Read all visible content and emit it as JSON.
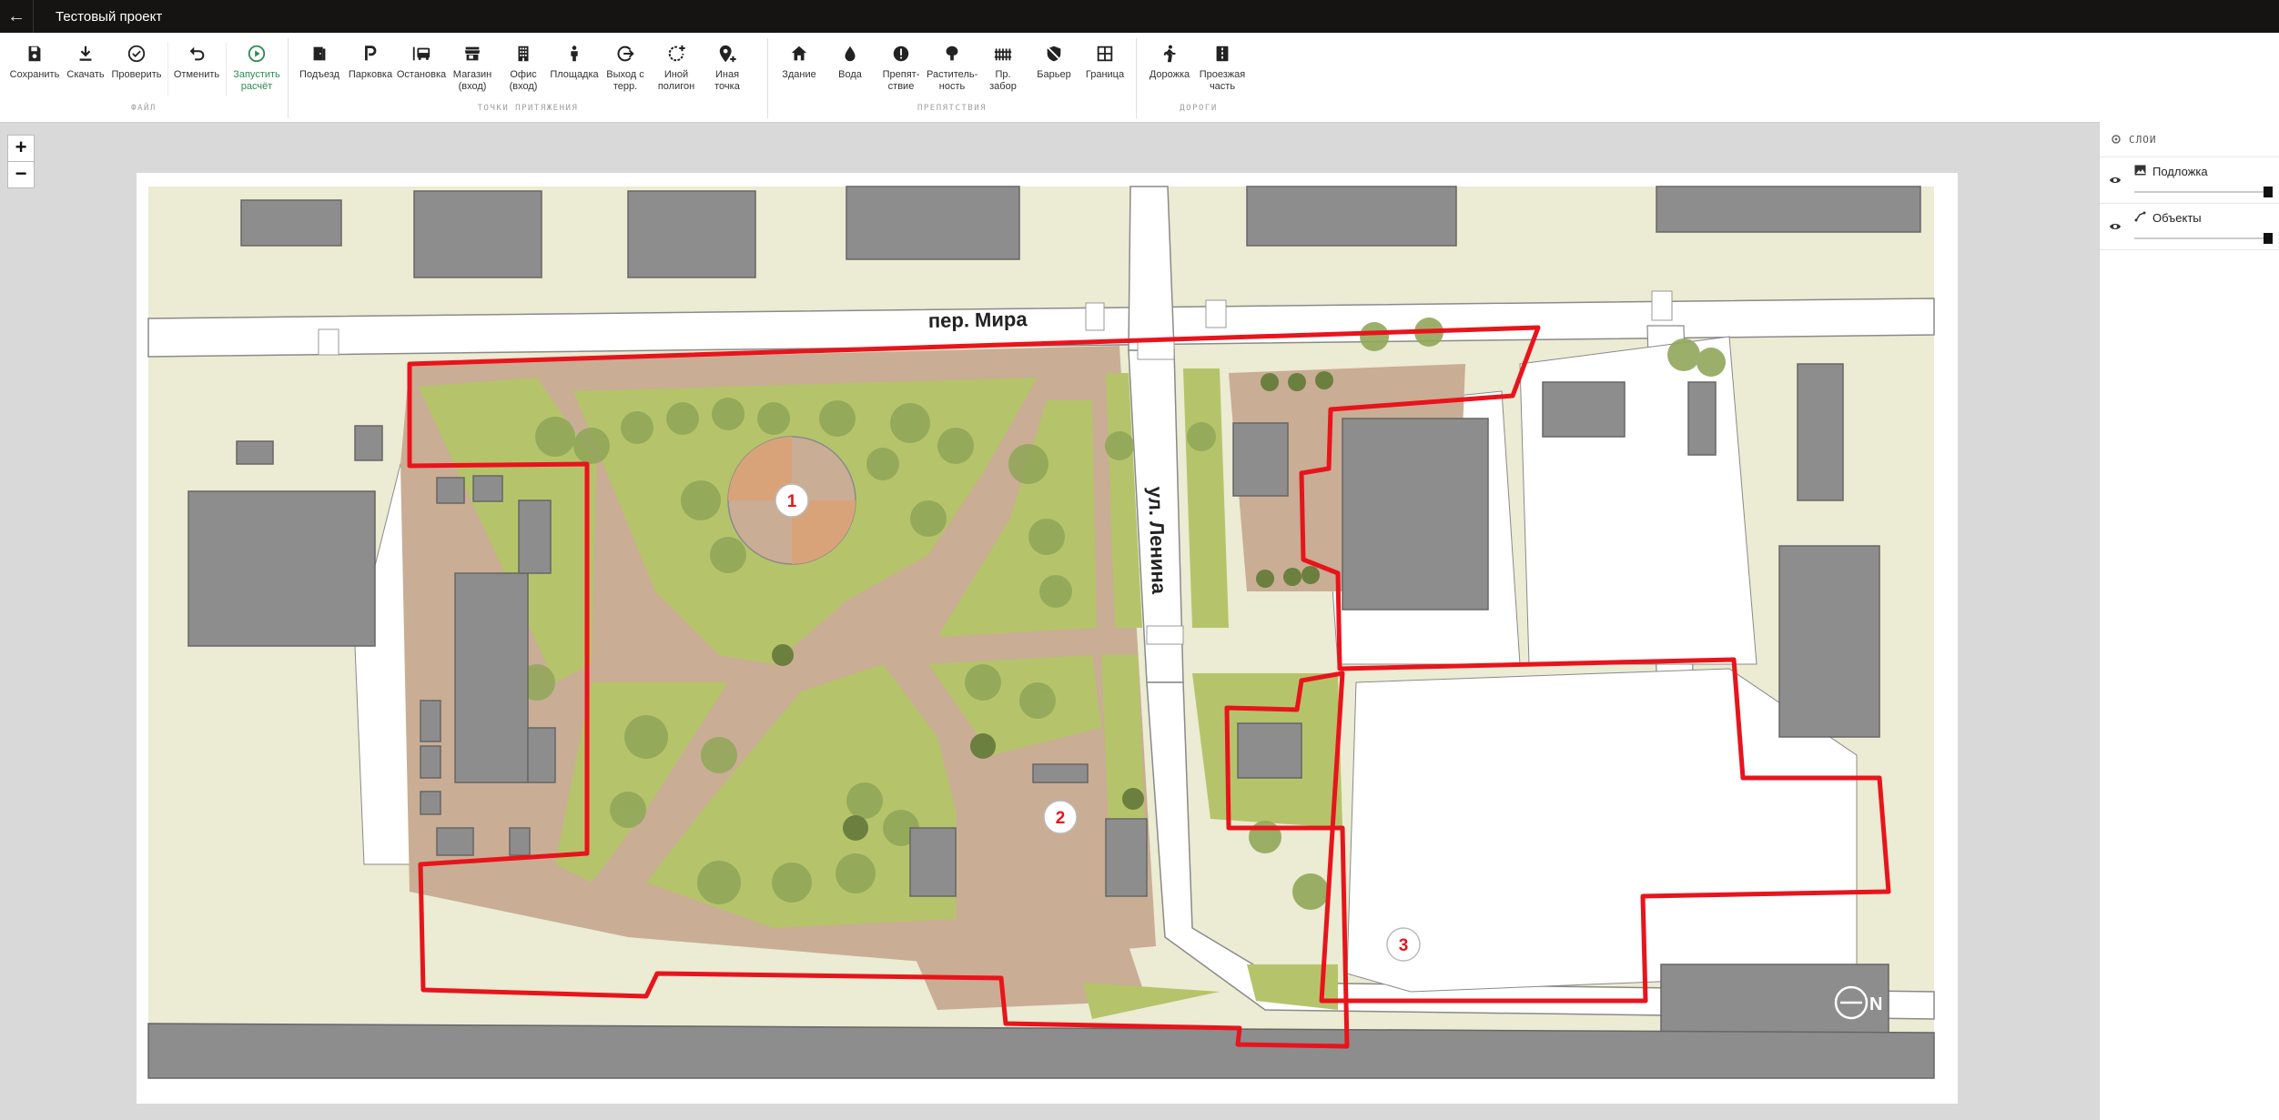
{
  "app": {
    "back_label": "←",
    "project_title": "Тестовый проект"
  },
  "toolbar": {
    "groups": [
      {
        "label": "файл"
      },
      {
        "label": "точки притяжения"
      },
      {
        "label": "препятствия"
      },
      {
        "label": "дороги"
      }
    ],
    "tools": {
      "save": "Сохранить",
      "download": "Скачать",
      "check": "Проверить",
      "undo": "Отменить",
      "run": "Запустить\nрасчёт",
      "entrance": "Подъезд",
      "parking": "Парковка",
      "stop": "Остановка",
      "shop": "Магазин\n(вход)",
      "office": "Офис\n(вход)",
      "playground": "Площадка",
      "exit": "Выход с\nтерр.",
      "polygon": "Иной\nполигон",
      "other_point": "Иная\nточка",
      "building": "Здание",
      "water": "Вода",
      "obstacle": "Препят-\nствие",
      "vegetation": "Раститель-\nность",
      "fence": "Пр.\nзабор",
      "barrier": "Барьер",
      "border": "Граница",
      "path": "Дорожка",
      "roadway": "Проезжая\nчасть"
    },
    "accent_color": "#2e8b57"
  },
  "zoom": {
    "in": "+",
    "out": "−"
  },
  "map": {
    "street_horizontal": "пер. Мира",
    "street_vertical": "ул. Ленина",
    "markers": [
      "1",
      "2",
      "3"
    ],
    "north_label": "N",
    "boundary_color": "#e8141c"
  },
  "layers": {
    "title": "слои",
    "items": [
      {
        "name": "Подложка",
        "opacity": 1.0
      },
      {
        "name": "Объекты",
        "opacity": 1.0
      }
    ]
  }
}
